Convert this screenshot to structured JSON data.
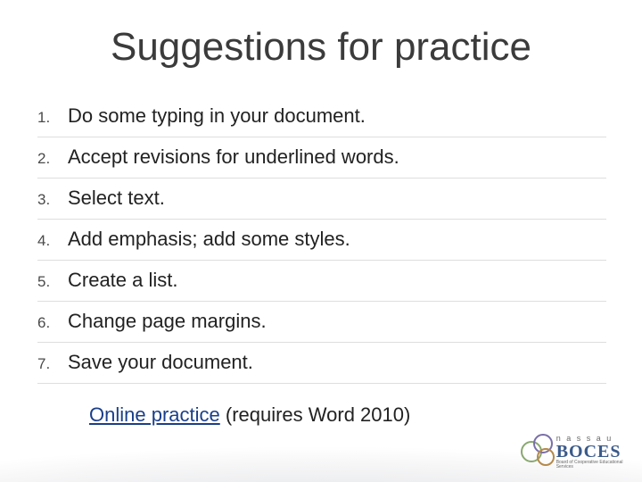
{
  "title": "Suggestions for practice",
  "list": {
    "items": [
      {
        "num": "1.",
        "text": "Do some typing in your document."
      },
      {
        "num": "2.",
        "text": "Accept revisions for underlined words."
      },
      {
        "num": "3.",
        "text": "Select text."
      },
      {
        "num": "4.",
        "text": "Add emphasis; add some styles."
      },
      {
        "num": "5.",
        "text": "Create a list."
      },
      {
        "num": "6.",
        "text": "Change page margins."
      },
      {
        "num": "7.",
        "text": "Save your document."
      }
    ]
  },
  "footer": {
    "link_text": "Online practice",
    "suffix": " (requires Word 2010)"
  },
  "logo": {
    "nassau": "n a s s a u",
    "boces": "BOCES",
    "sub": "Board of Cooperative Educational Services"
  }
}
